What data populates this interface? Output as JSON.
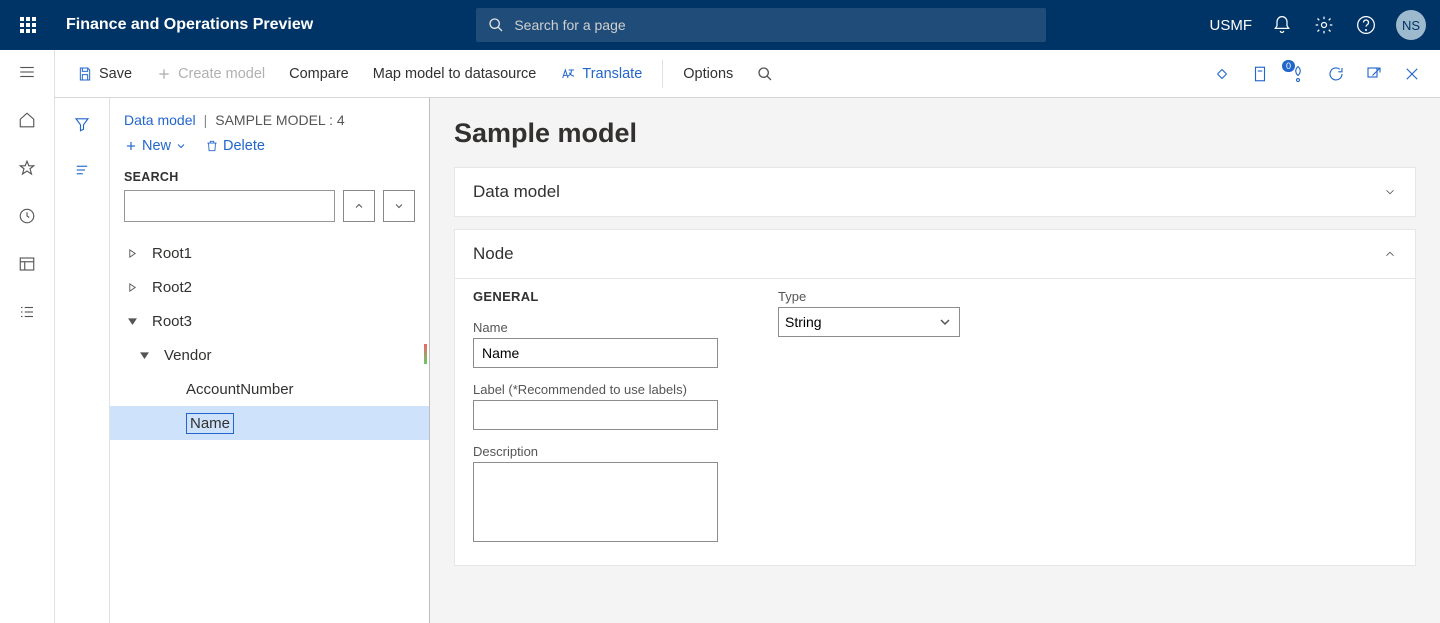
{
  "header": {
    "app_title": "Finance and Operations Preview",
    "search_placeholder": "Search for a page",
    "company": "USMF",
    "avatar_initials": "NS"
  },
  "cmdbar": {
    "save": "Save",
    "create_model": "Create model",
    "compare": "Compare",
    "map_model": "Map model to datasource",
    "translate": "Translate",
    "options": "Options",
    "badge_count": "0"
  },
  "breadcrumb": {
    "link": "Data model",
    "current": "SAMPLE MODEL : 4"
  },
  "toolbar2": {
    "new": "New",
    "delete": "Delete"
  },
  "search_section": {
    "title": "SEARCH"
  },
  "tree": {
    "root1": "Root1",
    "root2": "Root2",
    "root3": "Root3",
    "vendor": "Vendor",
    "account_number": "AccountNumber",
    "name_node": "Name"
  },
  "main": {
    "title": "Sample model",
    "card_data_model": "Data model",
    "card_node": "Node",
    "general": "GENERAL",
    "name_label": "Name",
    "name_value": "Name",
    "label_label": "Label (*Recommended to use labels)",
    "label_value": "",
    "desc_label": "Description",
    "desc_value": "",
    "type_label": "Type",
    "type_value": "String"
  }
}
